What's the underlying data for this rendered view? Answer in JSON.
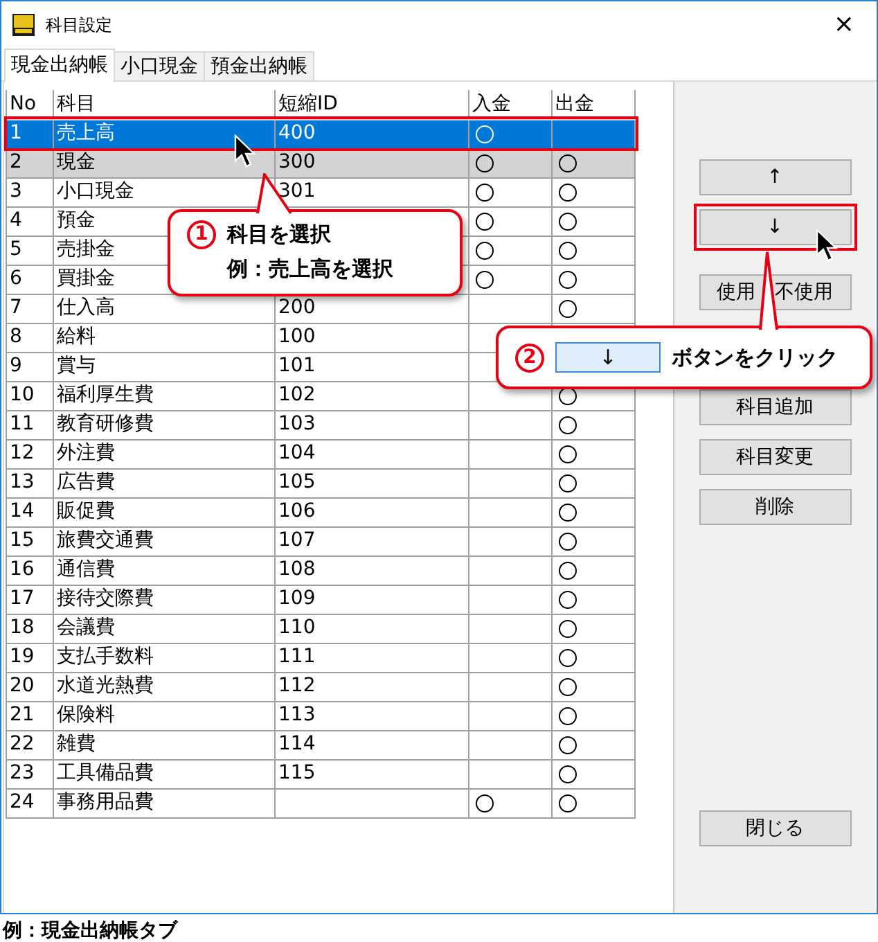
{
  "window": {
    "title": "科目設定",
    "close": "×"
  },
  "tabs": [
    {
      "label": "現金出納帳",
      "selected": true
    },
    {
      "label": "小口現金",
      "selected": false
    },
    {
      "label": "預金出納帳",
      "selected": false
    }
  ],
  "table": {
    "columns": [
      "No",
      "科目",
      "短縮ID",
      "入金",
      "出金"
    ],
    "rows": [
      {
        "no": "1",
        "name": "売上高",
        "id": "400",
        "in": true,
        "out": false,
        "selected": true,
        "shaded": false,
        "outlined": true
      },
      {
        "no": "2",
        "name": "現金",
        "id": "300",
        "in": true,
        "out": true,
        "selected": false,
        "shaded": true,
        "outlined": false
      },
      {
        "no": "3",
        "name": "小口現金",
        "id": "301",
        "in": true,
        "out": true,
        "selected": false,
        "shaded": false,
        "outlined": false
      },
      {
        "no": "4",
        "name": "預金",
        "in": true,
        "out": true,
        "selected": false,
        "shaded": false,
        "outlined": false
      },
      {
        "no": "5",
        "name": "売掛金",
        "in": true,
        "out": true,
        "selected": false,
        "shaded": false,
        "outlined": false
      },
      {
        "no": "6",
        "name": "買掛金",
        "in": true,
        "out": true,
        "selected": false,
        "shaded": false,
        "outlined": false
      },
      {
        "no": "7",
        "name": "仕入高",
        "id": "200",
        "in": false,
        "out": true,
        "selected": false,
        "shaded": false,
        "outlined": false
      },
      {
        "no": "8",
        "name": "給料",
        "id": "100",
        "in": false,
        "selected": false,
        "shaded": false,
        "outlined": false
      },
      {
        "no": "9",
        "name": "賞与",
        "id": "101",
        "in": false,
        "selected": false,
        "shaded": false,
        "outlined": false
      },
      {
        "no": "10",
        "name": "福利厚生費",
        "id": "102",
        "in": false,
        "out": true,
        "selected": false,
        "shaded": false,
        "outlined": false
      },
      {
        "no": "11",
        "name": "教育研修費",
        "id": "103",
        "in": false,
        "out": true,
        "selected": false,
        "shaded": false,
        "outlined": false
      },
      {
        "no": "12",
        "name": "外注費",
        "id": "104",
        "in": false,
        "out": true,
        "selected": false,
        "shaded": false,
        "outlined": false
      },
      {
        "no": "13",
        "name": "広告費",
        "id": "105",
        "in": false,
        "out": true,
        "selected": false,
        "shaded": false,
        "outlined": false
      },
      {
        "no": "14",
        "name": "販促費",
        "id": "106",
        "in": false,
        "out": true,
        "selected": false,
        "shaded": false,
        "outlined": false
      },
      {
        "no": "15",
        "name": "旅費交通費",
        "id": "107",
        "in": false,
        "out": true,
        "selected": false,
        "shaded": false,
        "outlined": false
      },
      {
        "no": "16",
        "name": "通信費",
        "id": "108",
        "in": false,
        "out": true,
        "selected": false,
        "shaded": false,
        "outlined": false
      },
      {
        "no": "17",
        "name": "接待交際費",
        "id": "109",
        "in": false,
        "out": true,
        "selected": false,
        "shaded": false,
        "outlined": false
      },
      {
        "no": "18",
        "name": "会議費",
        "id": "110",
        "in": false,
        "out": true,
        "selected": false,
        "shaded": false,
        "outlined": false
      },
      {
        "no": "19",
        "name": "支払手数料",
        "id": "111",
        "in": false,
        "out": true,
        "selected": false,
        "shaded": false,
        "outlined": false
      },
      {
        "no": "20",
        "name": "水道光熱費",
        "id": "112",
        "in": false,
        "out": true,
        "selected": false,
        "shaded": false,
        "outlined": false
      },
      {
        "no": "21",
        "name": "保険料",
        "id": "113",
        "in": false,
        "out": true,
        "selected": false,
        "shaded": false,
        "outlined": false
      },
      {
        "no": "22",
        "name": "雑費",
        "id": "114",
        "in": false,
        "out": true,
        "selected": false,
        "shaded": false,
        "outlined": false
      },
      {
        "no": "23",
        "name": "工具備品費",
        "id": "115",
        "in": false,
        "out": true,
        "selected": false,
        "shaded": false,
        "outlined": false
      },
      {
        "no": "24",
        "name": "事務用品費",
        "in": true,
        "out": true,
        "selected": false,
        "shaded": false,
        "outlined": false
      }
    ]
  },
  "buttons": [
    {
      "label": "↑"
    },
    {
      "label": "↓",
      "outlined": true
    },
    {
      "label": "使用 不使用"
    },
    {
      "label": "科目追加"
    },
    {
      "label": "科目変更"
    },
    {
      "label": "削除"
    },
    {
      "label": "閉じる"
    }
  ],
  "callouts": [
    {
      "number": "1",
      "lines": [
        "科目を選択",
        "例：売上高を選択"
      ]
    },
    {
      "number": "2",
      "button_label": "↓",
      "text": "ボタンをクリック"
    }
  ],
  "caption": "例：現金出納帳タブ"
}
